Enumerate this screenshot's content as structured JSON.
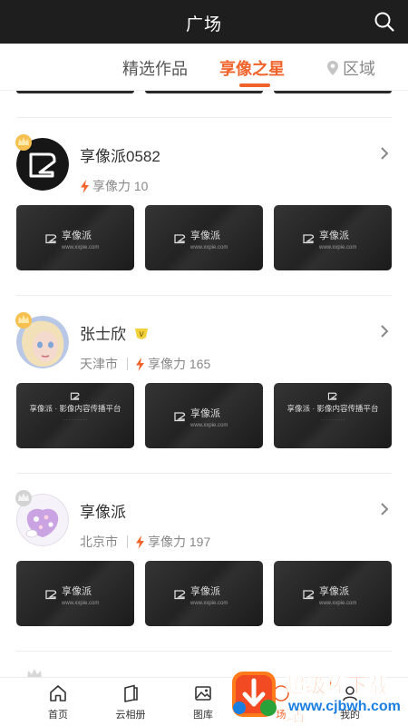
{
  "header": {
    "title": "广场"
  },
  "tabs": [
    {
      "label": "精选作品"
    },
    {
      "label": "享像之星"
    },
    {
      "label": "区域"
    }
  ],
  "users": [
    {
      "name": "享像派0582",
      "city": "",
      "power_label": "享像力 10",
      "verified": false,
      "thumbs": [
        {
          "style": "brand",
          "brand": "享像派",
          "url": "www.xxpie.com"
        },
        {
          "style": "brand",
          "brand": "享像派",
          "url": "www.xxpie.com"
        },
        {
          "style": "brand",
          "brand": "享像派",
          "url": "www.xxpie.com"
        }
      ]
    },
    {
      "name": "张士欣",
      "city": "天津市",
      "power_label": "享像力 165",
      "verified": true,
      "thumbs": [
        {
          "style": "slogan",
          "slogan": "享像派 · 影像内容传播平台"
        },
        {
          "style": "brand",
          "brand": "享像派",
          "url": "www.xxpie.com"
        },
        {
          "style": "slogan",
          "slogan": "享像派 · 影像内容传播平台"
        }
      ]
    },
    {
      "name": "享像派",
      "city": "北京市",
      "power_label": "享像力 197",
      "verified": false,
      "thumbs": [
        {
          "style": "brand",
          "brand": "享像派",
          "url": "www.xxpie.com"
        },
        {
          "style": "brand",
          "brand": "享像派",
          "url": "www.xxpie.com"
        },
        {
          "style": "brand",
          "brand": "享像派",
          "url": "www.xxpie.com"
        }
      ]
    }
  ],
  "bottom_nav": [
    {
      "label": "首页"
    },
    {
      "label": "云相册"
    },
    {
      "label": "图库"
    },
    {
      "label": "场"
    },
    {
      "label": "我的"
    }
  ],
  "watermark": {
    "text": "超级棒下载站",
    "url": "www.cjbwh.com"
  },
  "colors": {
    "accent": "#f0642b",
    "header_bg": "#1e1e1e",
    "power_bolt": "#f0642b"
  }
}
